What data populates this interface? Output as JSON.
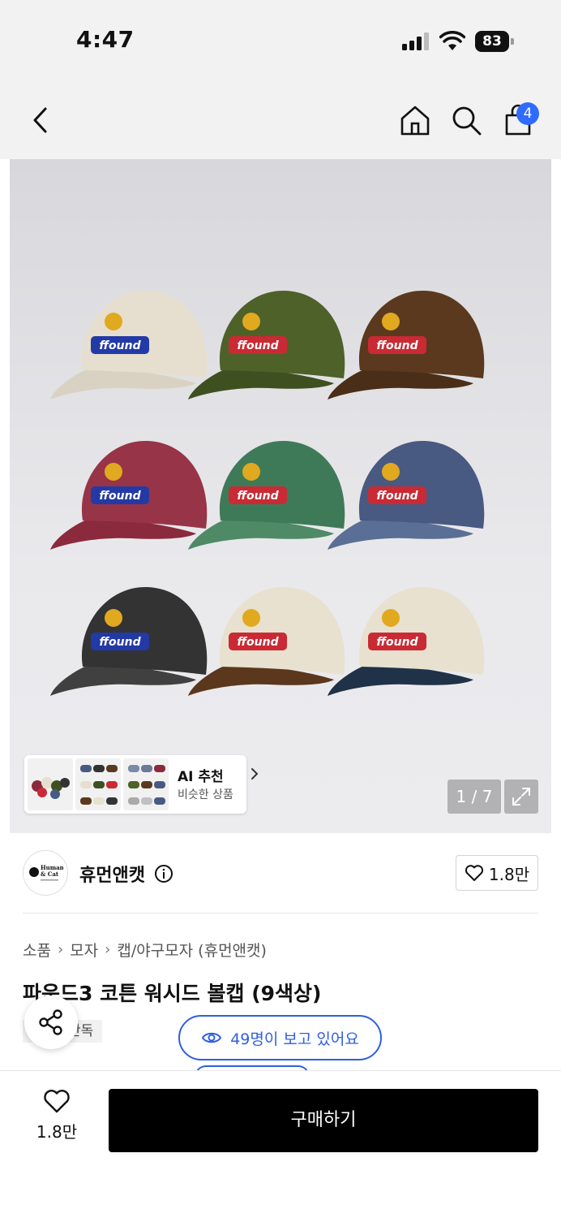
{
  "status_bar": {
    "time": "4:47",
    "battery": "83"
  },
  "nav": {
    "cart_count": "4",
    "icons": [
      "back-icon",
      "home-icon",
      "search-icon",
      "shopping-bag-icon"
    ]
  },
  "product_image": {
    "counter": "1 / 7"
  },
  "ai_recommend": {
    "title": "AI 추천",
    "subtitle": "비슷한 상품"
  },
  "brand": {
    "name": "휴먼앤캣",
    "logo_text_1": "Human",
    "logo_text_2": "& Cat",
    "likes": "1.8만"
  },
  "breadcrumb": [
    "소품",
    "모자",
    "캡/야구모자 (휴먼앤캣)"
  ],
  "product": {
    "title": "파운드3 코튼 워시드 볼캡 (9색상)",
    "tag": "단독"
  },
  "viewers": {
    "label": "49명이 보고 있어요"
  },
  "bottom": {
    "wish_count": "1.8만",
    "buy_label": "구매하기"
  },
  "colors": {
    "accent_blue": "#2f5fe0",
    "badge_blue": "#2f6bff",
    "buy_bg": "#000000"
  }
}
